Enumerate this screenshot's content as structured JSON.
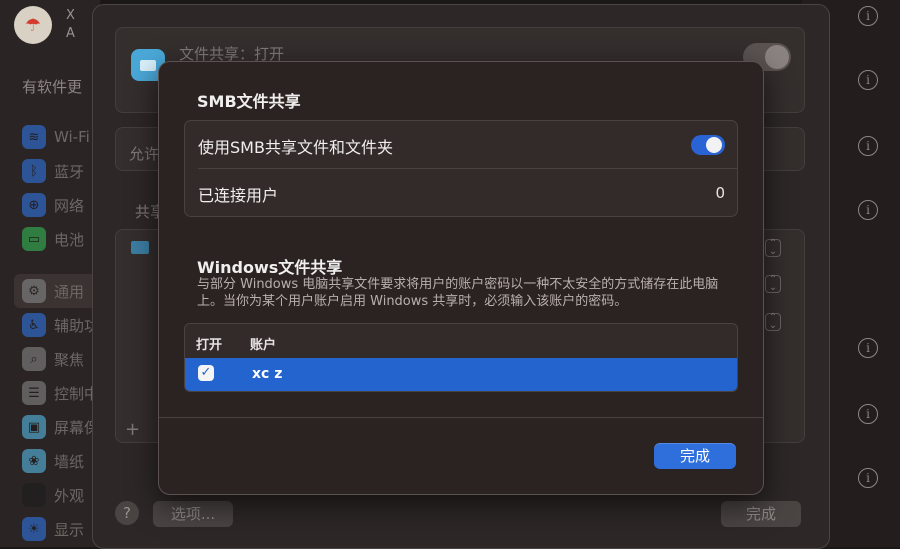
{
  "sidebar": {
    "account_initial": "X",
    "account_sub": "A",
    "updates_label": "有软件更",
    "items": [
      {
        "label": "Wi-Fi",
        "icon": "wifi-icon",
        "color": "#2f7cf6",
        "glyph": "≋"
      },
      {
        "label": "蓝牙",
        "icon": "bluetooth-icon",
        "color": "#2f7cf6",
        "glyph": "ᛒ"
      },
      {
        "label": "网络",
        "icon": "globe-icon",
        "color": "#2f7cf6",
        "glyph": "⊕"
      },
      {
        "label": "电池",
        "icon": "battery-icon",
        "color": "#34c759",
        "glyph": "▭"
      },
      {
        "label": "通用",
        "icon": "gear-icon",
        "color": "#8e8e93",
        "glyph": "⚙"
      },
      {
        "label": "辅助功",
        "icon": "accessibility-icon",
        "color": "#2f7cf6",
        "glyph": "♿"
      },
      {
        "label": "聚焦",
        "icon": "search-icon",
        "color": "#8e8e93",
        "glyph": "⌕"
      },
      {
        "label": "控制中",
        "icon": "control-center-icon",
        "color": "#8e8e93",
        "glyph": "☰"
      },
      {
        "label": "屏幕保",
        "icon": "screensaver-icon",
        "color": "#5ac8fa",
        "glyph": "▣"
      },
      {
        "label": "墙纸",
        "icon": "wallpaper-icon",
        "color": "#5ac8fa",
        "glyph": "❀"
      },
      {
        "label": "外观",
        "icon": "appearance-icon",
        "color": "#1c1c1e",
        "glyph": "◐"
      },
      {
        "label": "显示",
        "icon": "display-icon",
        "color": "#2f7cf6",
        "glyph": "☀"
      }
    ]
  },
  "sheet": {
    "title": "文件共享：打开",
    "allow_label": "允许",
    "shared_label": "共享",
    "add_label": "+",
    "help_label": "?",
    "options_label": "选项...",
    "done_label": "完成"
  },
  "dialog": {
    "title": "SMB文件共享",
    "smb_toggle_label": "使用SMB共享文件和文件夹",
    "connected_label": "已连接用户",
    "connected_count": "0",
    "windows_title": "Windows文件共享",
    "windows_desc": "与部分 Windows 电脑共享文件要求将用户的账户密码以一种不太安全的方式储存在此电脑上。当你为某个用户账户启用 Windows 共享时，必须输入该账户的密码。",
    "table": {
      "col_enable": "打开",
      "col_account": "账户",
      "rows": [
        {
          "checked": true,
          "account": "xc z"
        }
      ]
    },
    "done_label": "完成"
  },
  "colors": {
    "accent": "#2e6fdc",
    "selection": "#2364cf",
    "dialog_bg": "#2b2322"
  }
}
